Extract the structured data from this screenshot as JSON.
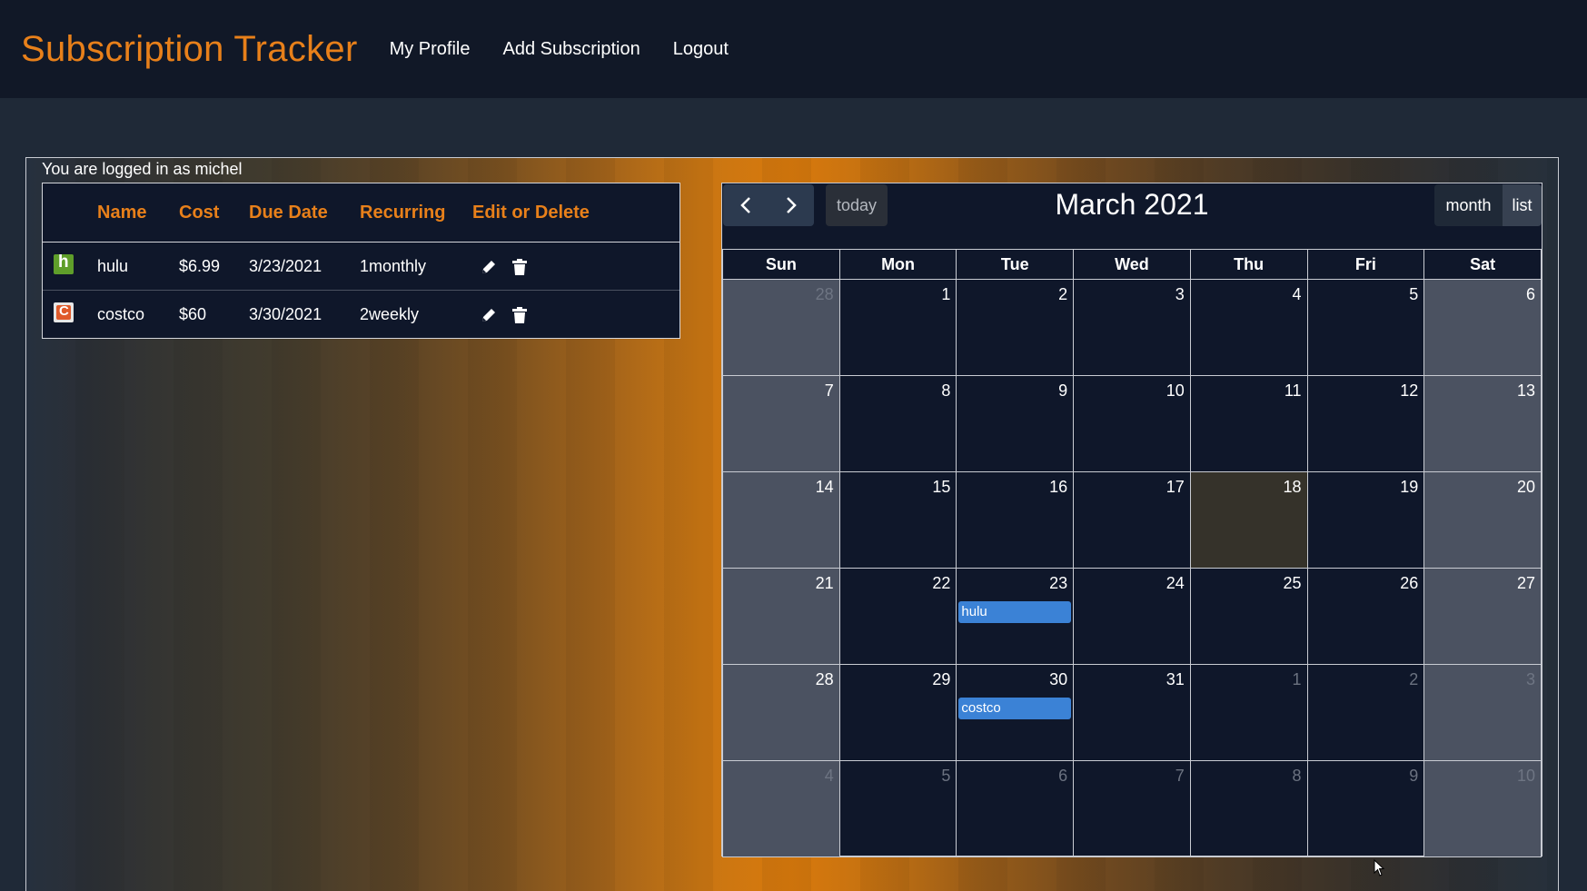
{
  "navbar": {
    "brand": "Subscription Tracker",
    "links": [
      "My Profile",
      "Add Subscription",
      "Logout"
    ]
  },
  "login_note": "You are logged in as michel",
  "subscriptions": {
    "headers": [
      "Name",
      "Cost",
      "Due Date",
      "Recurring",
      "Edit or Delete"
    ],
    "rows": [
      {
        "logo": "hulu-logo",
        "name": "hulu",
        "cost": "$6.99",
        "due": "3/23/2021",
        "recurring": "1monthly"
      },
      {
        "logo": "costco-logo",
        "name": "costco",
        "cost": "$60",
        "due": "3/30/2021",
        "recurring": "2weekly"
      }
    ]
  },
  "calendar": {
    "title": "March 2021",
    "today_label": "today",
    "month_label": "month",
    "list_label": "list",
    "weekdays": [
      "Sun",
      "Mon",
      "Tue",
      "Wed",
      "Thu",
      "Fri",
      "Sat"
    ],
    "weeks": [
      [
        "28",
        "1",
        "2",
        "3",
        "4",
        "5",
        "6"
      ],
      [
        "7",
        "8",
        "9",
        "10",
        "11",
        "12",
        "13"
      ],
      [
        "14",
        "15",
        "16",
        "17",
        "18",
        "19",
        "20"
      ],
      [
        "21",
        "22",
        "23",
        "24",
        "25",
        "26",
        "27"
      ],
      [
        "28",
        "29",
        "30",
        "31",
        "1",
        "2",
        "3"
      ],
      [
        "4",
        "5",
        "6",
        "7",
        "8",
        "9",
        "10"
      ]
    ],
    "today_date": "18",
    "events": [
      {
        "date": "23",
        "label": "hulu"
      },
      {
        "date": "30",
        "label": "costco"
      }
    ],
    "event_color": "#3b82d6"
  },
  "colors": {
    "accent": "#e8801a",
    "navbar_bg": "#111827",
    "page_bg": "#1f2937"
  }
}
